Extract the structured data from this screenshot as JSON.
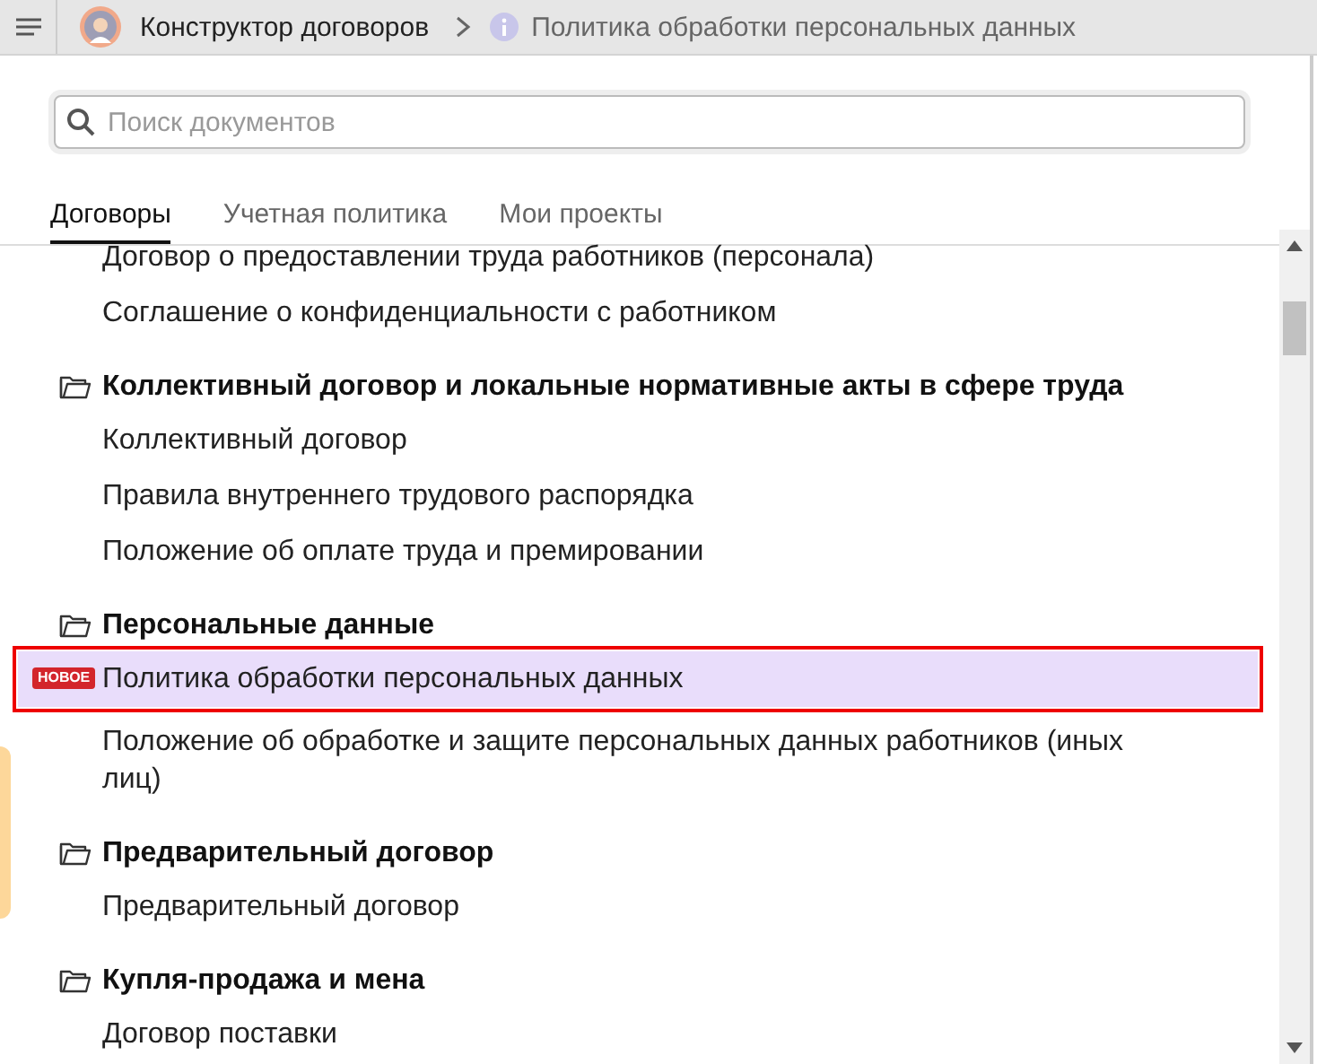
{
  "breadcrumb": {
    "root": "Конструктор договоров",
    "current": "Политика обработки персональных данных"
  },
  "search": {
    "placeholder": "Поиск документов"
  },
  "tabs": [
    {
      "label": "Договоры",
      "selected": true
    },
    {
      "label": "Учетная политика",
      "selected": false
    },
    {
      "label": "Мои проекты",
      "selected": false
    }
  ],
  "groups": [
    {
      "items": [
        {
          "label": "Договор о предоставлении труда работников (персонала)",
          "selected": false
        },
        {
          "label": "Соглашение о конфиденциальности с работником",
          "selected": false
        }
      ]
    },
    {
      "title": "Коллективный договор и локальные нормативные акты в сфере труда",
      "items": [
        {
          "label": "Коллективный договор",
          "selected": false
        },
        {
          "label": "Правила внутреннего трудового распорядка",
          "selected": false
        },
        {
          "label": "Положение об оплате труда и премировании",
          "selected": false
        }
      ]
    },
    {
      "title": "Персональные данные",
      "items": [
        {
          "label": "Политика обработки персональных данных",
          "selected": true,
          "badge": "НОВОЕ"
        },
        {
          "label": "Положение об обработке и защите персональных данных работников (иных лиц)",
          "selected": false
        }
      ]
    },
    {
      "title": "Предварительный договор",
      "items": [
        {
          "label": "Предварительный договор",
          "selected": false
        }
      ]
    },
    {
      "title": "Купля-продажа и мена",
      "items": [
        {
          "label": "Договор поставки",
          "selected": false
        }
      ]
    }
  ]
}
